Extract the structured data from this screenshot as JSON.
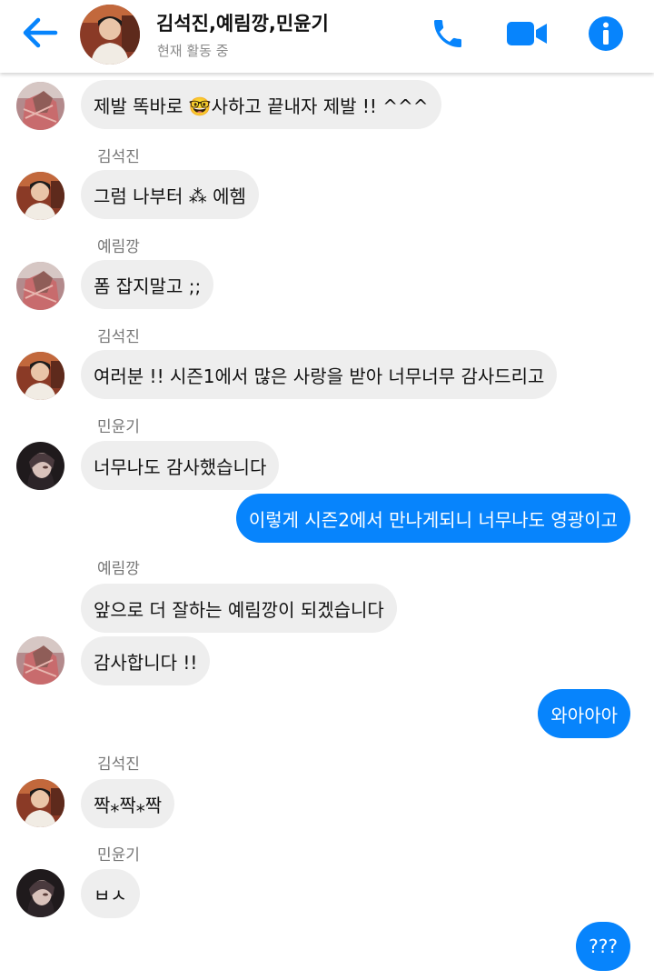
{
  "header": {
    "title": "김석진,예림깡,민윤기",
    "status": "현재 활동 중",
    "back_icon": "arrow-left-icon",
    "phone_icon": "phone-icon",
    "video_icon": "video-camera-icon",
    "info_icon": "info-icon",
    "accent_color": "#0784fc"
  },
  "messages": [
    {
      "sender": "",
      "direction": "in",
      "avatar": "yerim",
      "text": "제발 똑바로 🤓사하고 끝내자 제발 !! ^^^"
    },
    {
      "sender": "김석진",
      "direction": "in",
      "avatar": "seokjin",
      "text": "그럼 나부터 ⁂ 에헴"
    },
    {
      "sender": "예림깡",
      "direction": "in",
      "avatar": "yerim",
      "text": "폼 잡지말고 ;;"
    },
    {
      "sender": "김석진",
      "direction": "in",
      "avatar": "seokjin",
      "text": "여러분 !! 시즌1에서 많은 사랑을 받아 너무너무 감사드리고"
    },
    {
      "sender": "민윤기",
      "direction": "in",
      "avatar": "yoongi",
      "text": "너무나도 감사했습니다"
    },
    {
      "sender": "",
      "direction": "out",
      "avatar": "",
      "text": "이렇게 시즌2에서 만나게되니 너무나도 영광이고"
    },
    {
      "sender": "예림깡",
      "direction": "in",
      "avatar": "",
      "text": "앞으로 더 잘하는 예림깡이 되겠습니다"
    },
    {
      "sender": "",
      "direction": "in",
      "avatar": "yerim",
      "text": "감사합니다 !!"
    },
    {
      "sender": "",
      "direction": "out",
      "avatar": "",
      "text": "와아아아"
    },
    {
      "sender": "김석진",
      "direction": "in",
      "avatar": "seokjin",
      "text": "짝⁎짝⁎짝"
    },
    {
      "sender": "민윤기",
      "direction": "in",
      "avatar": "yoongi",
      "text": "ㅂㅅ"
    },
    {
      "sender": "",
      "direction": "out",
      "avatar": "",
      "text": "???"
    }
  ]
}
